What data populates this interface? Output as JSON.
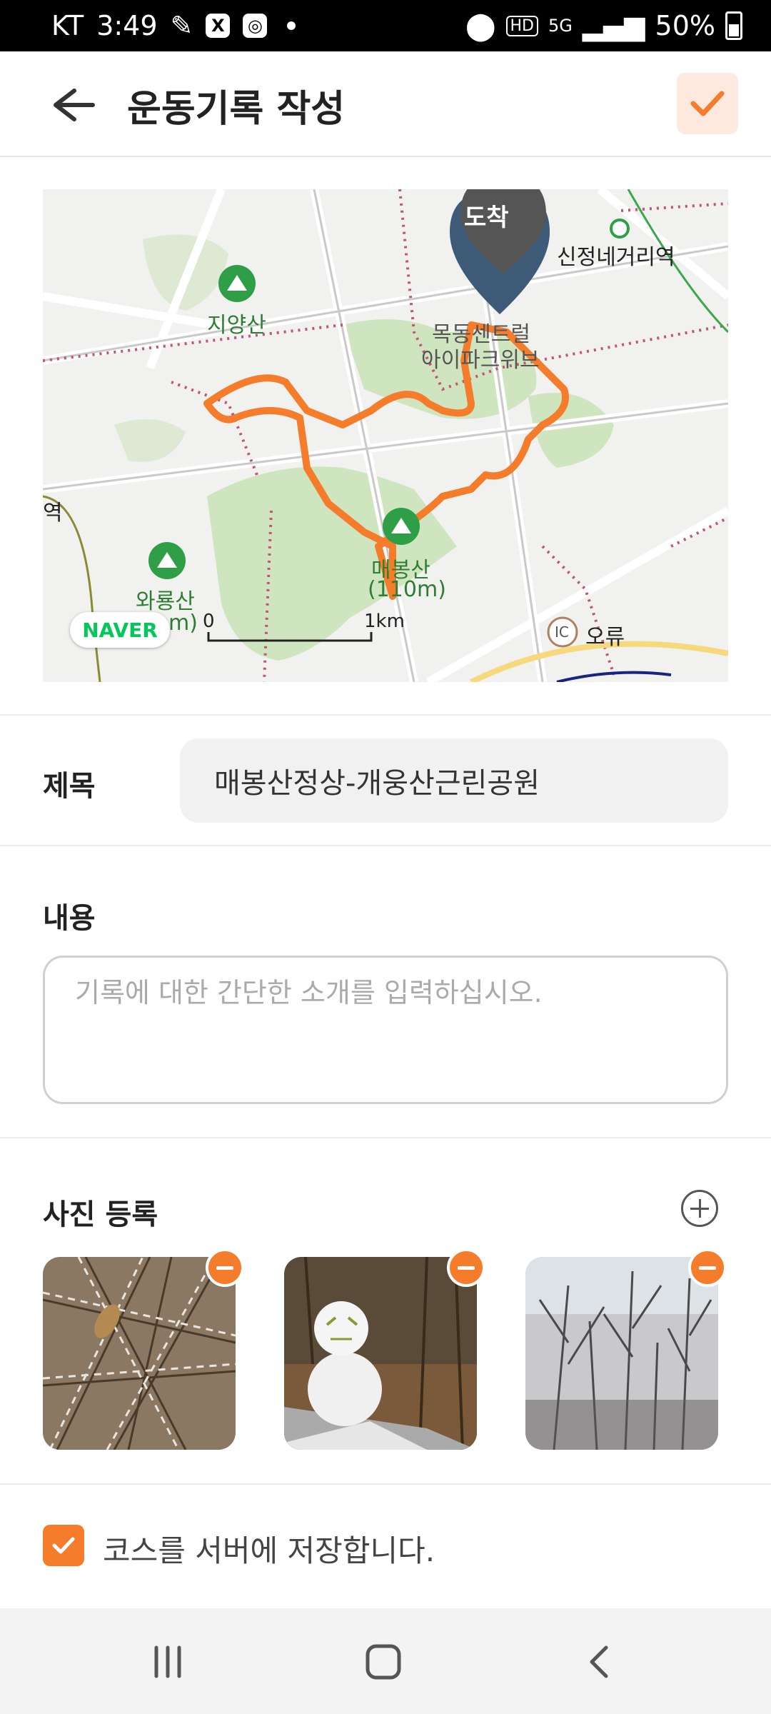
{
  "status_bar": {
    "carrier": "KT",
    "time": "3:49",
    "battery": "50%",
    "network": "5G",
    "hd": "HD"
  },
  "header": {
    "title": "운동기록 작성"
  },
  "map": {
    "arrival_marker": "도착",
    "labels": {
      "station": "신정네거리역",
      "mountain_jiyang": "지양산",
      "apartment_line1": "목동센트럴",
      "apartment_line2": "아이파크위브",
      "mountain_maebong_line1": "매봉산",
      "mountain_maebong_line2": "(110m)",
      "mountain_wawryong_line1": "와룡산",
      "mountain_wawryong_line2": "m)",
      "ic": "IC",
      "oryu": "오류",
      "edge_label": "역",
      "scale_start": "0",
      "scale_end": "1km",
      "provider": "NAVER"
    },
    "route_color": "#f57c2a"
  },
  "form": {
    "title_label": "제목",
    "title_value": "매봉산정상-개웅산근린공원",
    "content_label": "내용",
    "content_placeholder": "기록에 대한 간단한 소개를 입력하십시오.",
    "photo_label": "사진 등록",
    "save_course_label": "코스를 서버에 저장합니다."
  },
  "colors": {
    "accent": "#f57c2a",
    "accent_light": "#fde9dd"
  },
  "icons": {
    "back": "arrow-left-icon",
    "confirm": "check-icon",
    "add_photo": "plus-circle-icon",
    "remove_photo": "minus-circle-icon",
    "nav_recent": "recent-apps-icon",
    "nav_home": "home-icon",
    "nav_back": "chevron-left-icon"
  }
}
